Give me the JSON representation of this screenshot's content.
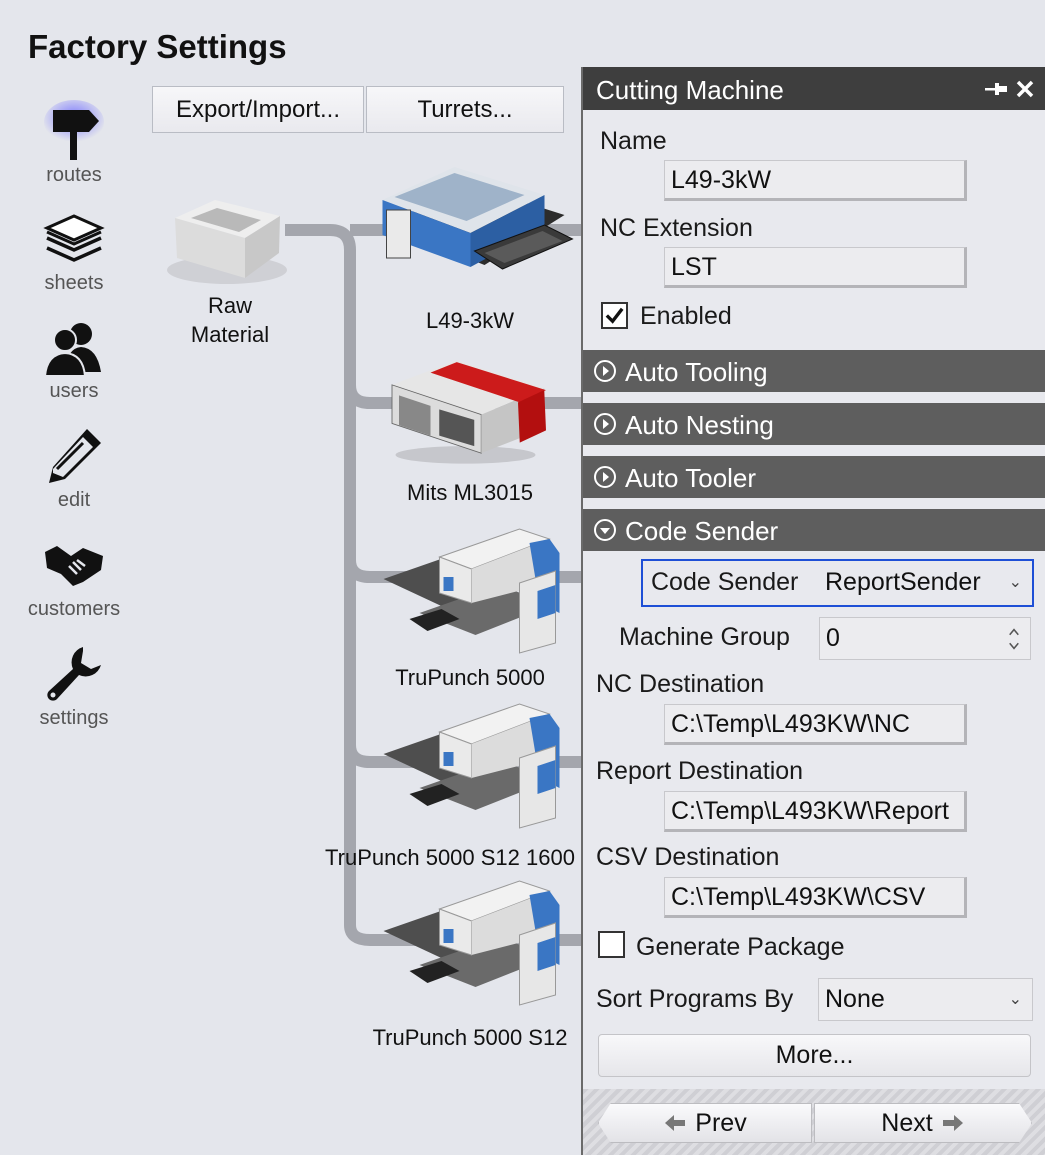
{
  "page": {
    "title": "Factory Settings"
  },
  "nav": {
    "items": [
      {
        "label": "routes",
        "icon": "signpost-icon",
        "active": true
      },
      {
        "label": "sheets",
        "icon": "sheets-stack-icon"
      },
      {
        "label": "users",
        "icon": "users-icon"
      },
      {
        "label": "edit",
        "icon": "pencil-icon"
      },
      {
        "label": "customers",
        "icon": "handshake-icon"
      },
      {
        "label": "settings",
        "icon": "wrench-icon"
      }
    ]
  },
  "toolbar": {
    "export_label": "Export/Import...",
    "turrets_label": "Turrets..."
  },
  "routes": {
    "source": {
      "label_line1": "Raw",
      "label_line2": "Material",
      "icon": "material-box-icon"
    },
    "machines": [
      {
        "label": "L49-3kW",
        "icon": "laser-machine-icon",
        "accent": "#3a76c4"
      },
      {
        "label": "Mits ML3015",
        "icon": "laser-machine-icon",
        "accent": "#cc1b1b"
      },
      {
        "label": "TruPunch 5000",
        "icon": "punch-machine-icon",
        "accent": "#3a76c4"
      },
      {
        "label": "TruPunch 5000 S12 1600",
        "icon": "punch-machine-icon",
        "accent": "#3a76c4"
      },
      {
        "label": "TruPunch 5000 S12",
        "icon": "punch-machine-icon",
        "accent": "#3a76c4"
      }
    ]
  },
  "panel": {
    "title": "Cutting Machine",
    "name_label": "Name",
    "name_value": "L49-3kW",
    "nc_ext_label": "NC Extension",
    "nc_ext_value": "LST",
    "enabled_label": "Enabled",
    "enabled": true,
    "sections": [
      {
        "label": "Auto Tooling",
        "expanded": false
      },
      {
        "label": "Auto Nesting",
        "expanded": false
      },
      {
        "label": "Auto Tooler",
        "expanded": false
      },
      {
        "label": "Code Sender",
        "expanded": true
      }
    ],
    "code_sender": {
      "label": "Code Sender",
      "value": "ReportSender",
      "machine_group_label": "Machine Group",
      "machine_group_value": "0",
      "nc_dest_label": "NC Destination",
      "nc_dest_value": "C:\\Temp\\L493KW\\NC",
      "report_dest_label": "Report Destination",
      "report_dest_value": "C:\\Temp\\L493KW\\Report",
      "csv_dest_label": "CSV Destination",
      "csv_dest_value": "C:\\Temp\\L493KW\\CSV",
      "generate_package_label": "Generate Package",
      "generate_package": false,
      "sort_label": "Sort Programs By",
      "sort_value": "None",
      "more_label": "More..."
    },
    "prev_label": "Prev",
    "next_label": "Next"
  },
  "colors": {
    "header": "#3e3e3e",
    "section": "#5e5e5e",
    "focus": "#1e4fd6",
    "route_line": "#a4a6ad"
  }
}
